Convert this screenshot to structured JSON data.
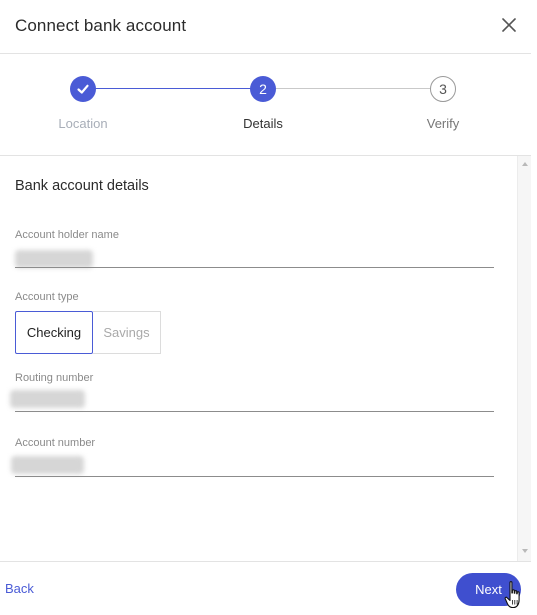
{
  "dialog": {
    "title": "Connect bank account",
    "close_icon": "close-icon"
  },
  "stepper": {
    "steps": [
      {
        "label": "Location",
        "marker": "",
        "state": "complete",
        "icon": "check-icon"
      },
      {
        "label": "Details",
        "marker": "2",
        "state": "active"
      },
      {
        "label": "Verify",
        "marker": "3",
        "state": "upcoming"
      }
    ]
  },
  "form": {
    "section_title": "Bank account details",
    "account_holder_name": {
      "label": "Account holder name",
      "value_redacted": true
    },
    "account_type": {
      "label": "Account type",
      "options": [
        "Checking",
        "Savings"
      ],
      "selected": "Checking"
    },
    "routing_number": {
      "label": "Routing number",
      "value_redacted": true
    },
    "account_number": {
      "label": "Account number",
      "value_redacted": true
    }
  },
  "footer": {
    "back_label": "Back",
    "next_label": "Next"
  },
  "colors": {
    "accent": "#4a5bd6",
    "next_button": "#3f4fcf",
    "muted_text": "#a8aeb8"
  }
}
